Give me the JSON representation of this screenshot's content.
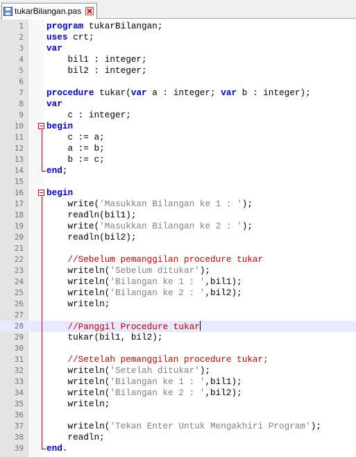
{
  "tab": {
    "filename": "tukarBilangan.pas"
  },
  "lines": [
    [
      [
        "program",
        "kw"
      ],
      [
        " tukarBilangan;",
        ""
      ]
    ],
    [
      [
        "uses",
        "kw"
      ],
      [
        " crt;",
        ""
      ]
    ],
    [
      [
        "var",
        "kw"
      ]
    ],
    [
      [
        "    bil1 : integer;",
        ""
      ]
    ],
    [
      [
        "    bil2 : integer;",
        ""
      ]
    ],
    [],
    [
      [
        "procedure",
        "kw"
      ],
      [
        " tukar(",
        ""
      ],
      [
        "var",
        "kw"
      ],
      [
        " a : integer; ",
        ""
      ],
      [
        "var",
        "kw"
      ],
      [
        " b : integer);",
        ""
      ]
    ],
    [
      [
        "var",
        "kw"
      ]
    ],
    [
      [
        "    c : integer;",
        ""
      ]
    ],
    [
      [
        "begin",
        "kw"
      ]
    ],
    [
      [
        "    c := a;",
        ""
      ]
    ],
    [
      [
        "    a := b;",
        ""
      ]
    ],
    [
      [
        "    b := c;",
        ""
      ]
    ],
    [
      [
        "end",
        "kw"
      ],
      [
        ";",
        ""
      ]
    ],
    [],
    [
      [
        "begin",
        "kw"
      ]
    ],
    [
      [
        "    write(",
        ""
      ],
      [
        "'Masukkan Bilangan ke 1 : '",
        "str"
      ],
      [
        ");",
        ""
      ]
    ],
    [
      [
        "    readln(bil1);",
        ""
      ]
    ],
    [
      [
        "    write(",
        ""
      ],
      [
        "'Masukkan Bilangan ke 2 : '",
        "str"
      ],
      [
        ");",
        ""
      ]
    ],
    [
      [
        "    readln(bil2);",
        ""
      ]
    ],
    [],
    [
      [
        "    //Sebelum pemanggilan procedure tukar",
        "cm"
      ]
    ],
    [
      [
        "    writeln(",
        ""
      ],
      [
        "'Sebelum ditukar'",
        "str"
      ],
      [
        ");",
        ""
      ]
    ],
    [
      [
        "    writeln(",
        ""
      ],
      [
        "'Bilangan ke 1 : '",
        "str"
      ],
      [
        ",bil1);",
        ""
      ]
    ],
    [
      [
        "    writeln(",
        ""
      ],
      [
        "'Bilangan ke 2 : '",
        "str"
      ],
      [
        ",bil2);",
        ""
      ]
    ],
    [
      [
        "    writeln;",
        ""
      ]
    ],
    [],
    [
      [
        "    //Panggil Procedure tukar",
        "cm"
      ]
    ],
    [
      [
        "    tukar(bil1, bil2);",
        ""
      ]
    ],
    [],
    [
      [
        "    //Setelah pemanggilan procedure tukar;",
        "cm"
      ]
    ],
    [
      [
        "    writeln(",
        ""
      ],
      [
        "'Setelah ditukar'",
        "str"
      ],
      [
        ");",
        ""
      ]
    ],
    [
      [
        "    writeln(",
        ""
      ],
      [
        "'Bilangan ke 1 : '",
        "str"
      ],
      [
        ",bil1);",
        ""
      ]
    ],
    [
      [
        "    writeln(",
        ""
      ],
      [
        "'Bilangan ke 2 : '",
        "str"
      ],
      [
        ",bil2);",
        ""
      ]
    ],
    [
      [
        "    writeln;",
        ""
      ]
    ],
    [],
    [
      [
        "    writeln(",
        ""
      ],
      [
        "'Tekan Enter Untuk Mengakhiri Program'",
        "str"
      ],
      [
        ");",
        ""
      ]
    ],
    [
      [
        "    readln;",
        ""
      ]
    ],
    [
      [
        "end",
        "kw"
      ],
      [
        ".",
        ""
      ]
    ]
  ],
  "active_line": 28,
  "fold_blocks": [
    [
      10,
      14
    ],
    [
      16,
      39
    ]
  ],
  "colors": {
    "keyword": "#0000c0",
    "string": "#808080",
    "comment": "#c00000",
    "fold": "#d00000"
  }
}
